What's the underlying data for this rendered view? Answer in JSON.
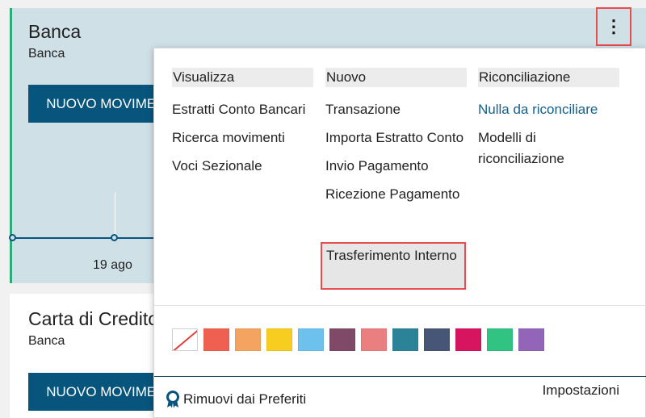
{
  "cards": [
    {
      "title": "Banca",
      "subtitle": "Banca",
      "button_label": "NUOVO MOVIMENTO"
    },
    {
      "title": "Carta di Credito",
      "subtitle": "Banca",
      "button_label": "NUOVO MOVIMENTO"
    }
  ],
  "chart": {
    "x_tick": "19 ago"
  },
  "menu": {
    "columns": [
      {
        "header": "Visualizza",
        "items": [
          "Estratti Conto Bancari",
          "Ricerca movimenti",
          "Voci Sezionale"
        ]
      },
      {
        "header": "Nuovo",
        "items": [
          "Transazione",
          "Importa Estratto Conto",
          "Invio Pagamento",
          "Ricezione Pagamento",
          "Trasferimento Interno"
        ]
      },
      {
        "header": "Riconciliazione",
        "items": [
          "Nulla da riconciliare",
          "Modelli di riconciliazione"
        ]
      }
    ],
    "colors": [
      "#ffffff",
      "#f06050",
      "#f4a460",
      "#f7cd1f",
      "#6cc1ed",
      "#814968",
      "#eb7e7f",
      "#2c8397",
      "#475577",
      "#d6145f",
      "#30c381",
      "#9365b8"
    ],
    "footer_left": "Rimuovi dai Preferiti",
    "footer_right": "Impostazioni"
  },
  "icons": {
    "kebab": "vertical-ellipsis-icon",
    "ribbon": "ribbon-icon"
  },
  "accent_colors": {
    "primary": "#07557d",
    "highlight_border": "#e84c4f",
    "card_bg": "#cfe0e7"
  }
}
